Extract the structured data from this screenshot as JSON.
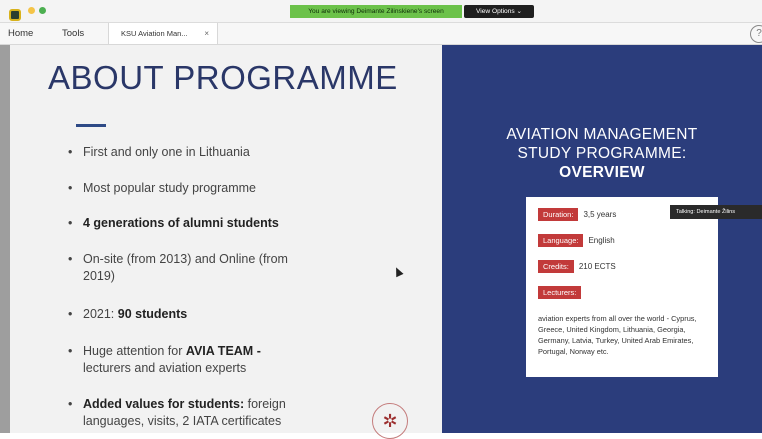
{
  "title_bar": {
    "sharing_banner": "You are viewing Deimante Zilinskiene's screen",
    "view_options_label": "View Options ⌄"
  },
  "tabs": [
    {
      "label": "Home"
    },
    {
      "label": "Tools"
    },
    {
      "label": "KSU Aviation Man..."
    }
  ],
  "slide_left": {
    "title": "ABOUT PROGRAMME",
    "bullets": [
      {
        "pre": "First and only one in Lithuania",
        "bold": "",
        "post": ""
      },
      {
        "pre": "Most popular study programme",
        "bold": "",
        "post": ""
      },
      {
        "pre": "",
        "bold": "4 generations of alumni students",
        "post": ""
      },
      {
        "pre": "On-site (from 2013) and Online (from 2019)",
        "bold": "",
        "post": ""
      },
      {
        "pre": "2021: ",
        "bold": "90 students",
        "post": ""
      },
      {
        "pre": "Huge attention for ",
        "bold": "AVIA TEAM -",
        "post": " lecturers and aviation experts"
      },
      {
        "pre": "",
        "bold": "Added values for students:",
        "post": " foreign languages, visits, 2 IATA certificates"
      }
    ]
  },
  "slide_right": {
    "heading_line1": "AVIATION MANAGEMENT",
    "heading_line2": "STUDY PROGRAMME:",
    "heading_line3": "OVERVIEW",
    "duration_label": "Duration:",
    "duration_value": "3,5 years",
    "language_label": "Language:",
    "language_value": "English",
    "credits_label": "Credits:",
    "credits_value": "210 ECTS",
    "lecturers_label": "Lecturers:",
    "lecturers_text": "aviation experts from all over the world - Cyprus, Greece, United Kingdom, Lithuania, Georgia, Germany, Latvia, Turkey, United Arab Emirates, Portugal, Norway etc."
  },
  "talking_tooltip": "Talking: Deimante Žilins",
  "colors": {
    "slide_blue": "#2b3d7c",
    "title_blue": "#2a3768",
    "label_red": "#c23a3a",
    "banner_green": "#6cc24a"
  },
  "icons": {
    "app": "app-logo-icon",
    "close": "close-icon",
    "help": "help-icon",
    "cursor": "mouse-cursor-icon"
  }
}
